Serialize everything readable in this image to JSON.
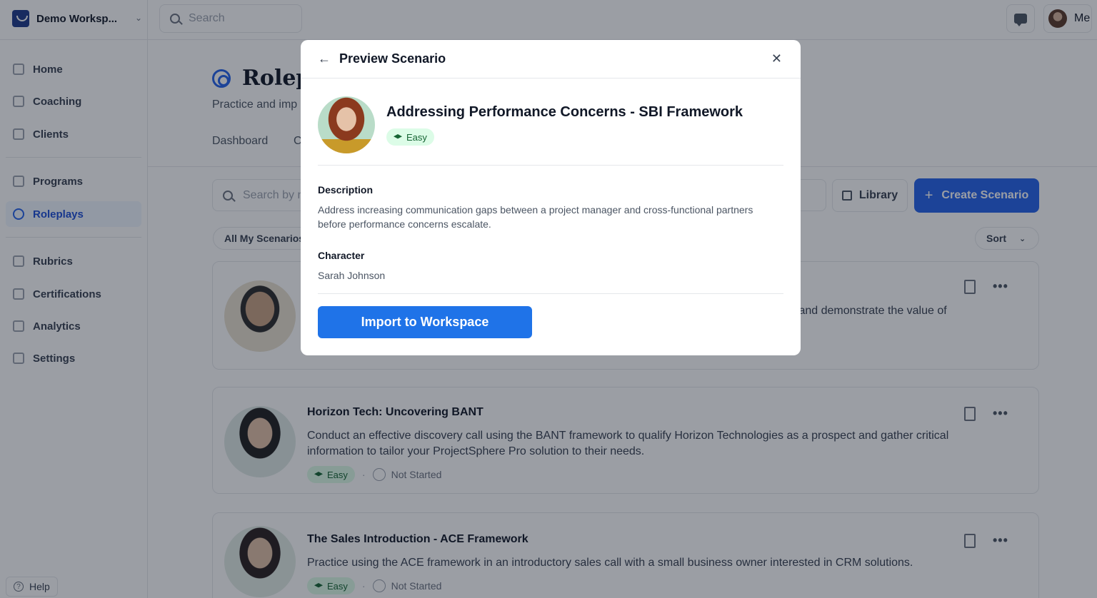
{
  "workspace": {
    "name": "Demo Worksp..."
  },
  "topbar": {
    "search_placeholder": "Search",
    "user_label": "Me"
  },
  "sidebar": {
    "items": [
      {
        "label": "Home",
        "icon": "home-icon"
      },
      {
        "label": "Coaching",
        "icon": "megaphone-icon"
      },
      {
        "label": "Clients",
        "icon": "building-icon"
      },
      {
        "label": "Programs",
        "icon": "network-icon"
      },
      {
        "label": "Roleplays",
        "icon": "target-icon",
        "active": true
      },
      {
        "label": "Rubrics",
        "icon": "list-icon"
      },
      {
        "label": "Certifications",
        "icon": "certificate-icon"
      },
      {
        "label": "Analytics",
        "icon": "chart-icon"
      },
      {
        "label": "Settings",
        "icon": "gear-icon"
      }
    ],
    "help_label": "Help"
  },
  "main": {
    "title": "Rolepl",
    "subtitle": "Practice and imp",
    "tabs": [
      "Dashboard",
      "C"
    ],
    "search_placeholder": "Search by n",
    "library_label": "Library",
    "create_label": "Create Scenario",
    "filter_label": "All My Scenarios",
    "sort_label": "Sort",
    "cards": [
      {
        "title": "",
        "description": "s and demonstrate the value of",
        "difficulty": "",
        "status": ""
      },
      {
        "title": "Horizon Tech: Uncovering BANT",
        "description": "Conduct an effective discovery call using the BANT framework to qualify Horizon Technologies as a prospect and gather critical information to tailor your ProjectSphere Pro solution to their needs.",
        "difficulty": "Easy",
        "status": "Not Started"
      },
      {
        "title": "The Sales Introduction - ACE Framework",
        "description": "Practice using the ACE framework in an introductory sales call with a small business owner interested in CRM solutions.",
        "difficulty": "Easy",
        "status": "Not Started"
      }
    ]
  },
  "modal": {
    "title": "Preview Scenario",
    "scenario_title": "Addressing Performance Concerns - SBI Framework",
    "difficulty": "Easy",
    "description_label": "Description",
    "description": "Address increasing communication gaps between a project manager and cross-functional partners before performance concerns escalate.",
    "character_label": "Character",
    "character": "Sarah Johnson",
    "import_label": "Import to Workspace"
  },
  "colors": {
    "primary": "#2563eb",
    "import_button": "#1f73e8",
    "easy_badge_bg": "#dcfce7",
    "easy_badge_text": "#166534"
  }
}
